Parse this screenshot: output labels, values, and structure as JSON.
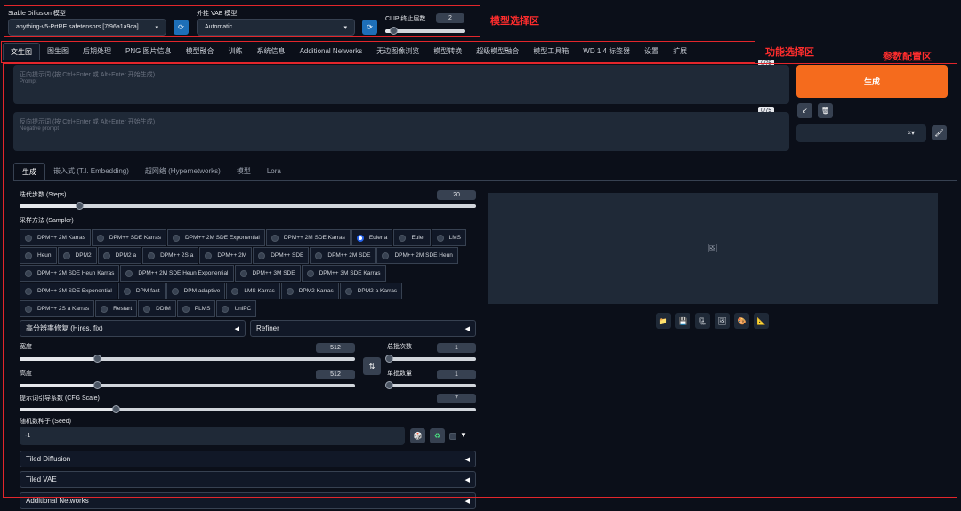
{
  "model_section": {
    "sd_model_label": "Stable Diffusion 模型",
    "sd_model_value": "anything-v5-PrtRE.safetensors [7f96a1a9ca]",
    "vae_label": "外挂 VAE 模型",
    "vae_value": "Automatic",
    "clip_label": "CLIP 终止层数",
    "clip_value": "2",
    "clip_fraction": 0.1
  },
  "annotations": {
    "model_area": "模型选择区",
    "function_area": "功能选择区",
    "param_area": "参数配置区"
  },
  "main_tabs": [
    "文生图",
    "图生图",
    "后期处理",
    "PNG 图片信息",
    "模型融合",
    "训练",
    "系统信息",
    "Additional Networks",
    "无边图像浏览",
    "模型转换",
    "超级模型融合",
    "模型工具箱",
    "WD 1.4 标签器",
    "设置",
    "扩展"
  ],
  "prompt": {
    "counter": "0/75",
    "placeholder_main": "正向提示词 (按 Ctrl+Enter 或 Alt+Enter 开始生成)",
    "placeholder_sub": "Prompt"
  },
  "negative_prompt": {
    "counter": "0/75",
    "placeholder_main": "反向提示词 (按 Ctrl+Enter 或 Alt+Enter 开始生成)",
    "placeholder_sub": "Negative prompt"
  },
  "generate_label": "生成",
  "sub_tabs": [
    "生成",
    "嵌入式 (T.I. Embedding)",
    "超网络 (Hypernetworks)",
    "模型",
    "Lora"
  ],
  "steps": {
    "label": "迭代步数 (Steps)",
    "value": "20",
    "fraction": 0.13
  },
  "sampler": {
    "label": "采样方法 (Sampler)",
    "selected": "Euler a",
    "rows": [
      [
        "DPM++ 2M Karras",
        "DPM++ SDE Karras",
        "DPM++ 2M SDE Exponential",
        "DPM++ 2M SDE Karras",
        "Euler a",
        "Euler",
        "LMS"
      ],
      [
        "Heun",
        "DPM2",
        "DPM2 a",
        "DPM++ 2S a",
        "DPM++ 2M",
        "DPM++ SDE",
        "DPM++ 2M SDE",
        "DPM++ 2M SDE Heun"
      ],
      [
        "DPM++ 2M SDE Heun Karras",
        "DPM++ 2M SDE Heun Exponential",
        "DPM++ 3M SDE",
        "DPM++ 3M SDE Karras"
      ],
      [
        "DPM++ 3M SDE Exponential",
        "DPM fast",
        "DPM adaptive",
        "LMS Karras",
        "DPM2 Karras",
        "DPM2 a Karras"
      ],
      [
        "DPM++ 2S a Karras",
        "Restart",
        "DDIM",
        "PLMS",
        "UniPC"
      ]
    ]
  },
  "hires_label": "高分辨率修复 (Hires. fix)",
  "refiner_label": "Refiner",
  "width": {
    "label": "宽度",
    "value": "512",
    "fraction": 0.23
  },
  "height": {
    "label": "高度",
    "value": "512",
    "fraction": 0.23
  },
  "batch_count": {
    "label": "总批次数",
    "value": "1",
    "fraction": 0.0
  },
  "batch_size": {
    "label": "单批数量",
    "value": "1",
    "fraction": 0.0
  },
  "cfg": {
    "label": "提示词引导系数 (CFG Scale)",
    "value": "7",
    "fraction": 0.21
  },
  "seed": {
    "label": "随机数种子 (Seed)",
    "value": "-1"
  },
  "extensions": [
    "Tiled Diffusion",
    "Tiled VAE",
    "Additional Networks"
  ]
}
